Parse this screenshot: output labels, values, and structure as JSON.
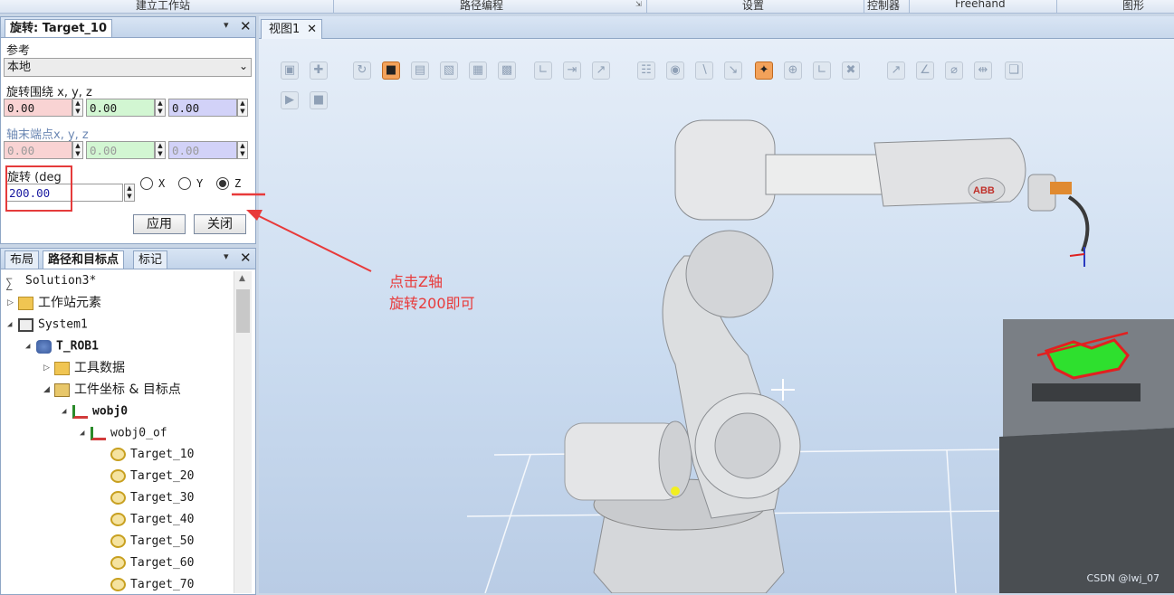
{
  "ribbon": {
    "groups": [
      "建立工作站",
      "路径编程",
      "设置",
      "控制器",
      "Freehand",
      "图形"
    ]
  },
  "rotate_panel": {
    "title": "旋转: Target_10",
    "ref_label": "参考",
    "ref_value": "本地",
    "axis_label": "旋转围绕 x, y, z",
    "axis_x": "0.00",
    "axis_y": "0.00",
    "axis_z": "0.00",
    "end_label": "轴末端点x, y, z",
    "end_x": "0.00",
    "end_y": "0.00",
    "end_z": "0.00",
    "deg_label": "旋转 (deg",
    "deg_value": "200.00",
    "radio_x": "X",
    "radio_y": "Y",
    "radio_z": "Z",
    "selected_axis": "Z",
    "apply_label": "应用",
    "close_label": "关闭"
  },
  "tree_panel": {
    "tabs": [
      "布局",
      "路径和目标点",
      "标记"
    ],
    "active_tab": "路径和目标点",
    "items": [
      {
        "label": "Solution3*"
      },
      {
        "label": "工作站元素"
      },
      {
        "label": "System1"
      },
      {
        "label": "T_ROB1"
      },
      {
        "label": "工具数据"
      },
      {
        "label": "工件坐标 & 目标点"
      },
      {
        "label": "wobj0"
      },
      {
        "label": "wobj0_of"
      },
      {
        "label": "Target_10"
      },
      {
        "label": "Target_20"
      },
      {
        "label": "Target_30"
      },
      {
        "label": "Target_40"
      },
      {
        "label": "Target_50"
      },
      {
        "label": "Target_60"
      },
      {
        "label": "Target_70"
      }
    ]
  },
  "view": {
    "tab_label": "视图1",
    "robot_brand": "ABB"
  },
  "annotation": {
    "line1": "点击Z轴",
    "line2": "旋转200即可",
    "color": "#e83a3a"
  },
  "watermark": "CSDN @lwj_07",
  "colors": {
    "x_field": "#f9d3d3",
    "y_field": "#d2f6d2",
    "z_field": "#d2d2f8",
    "active_tool": "#f3a25a"
  }
}
